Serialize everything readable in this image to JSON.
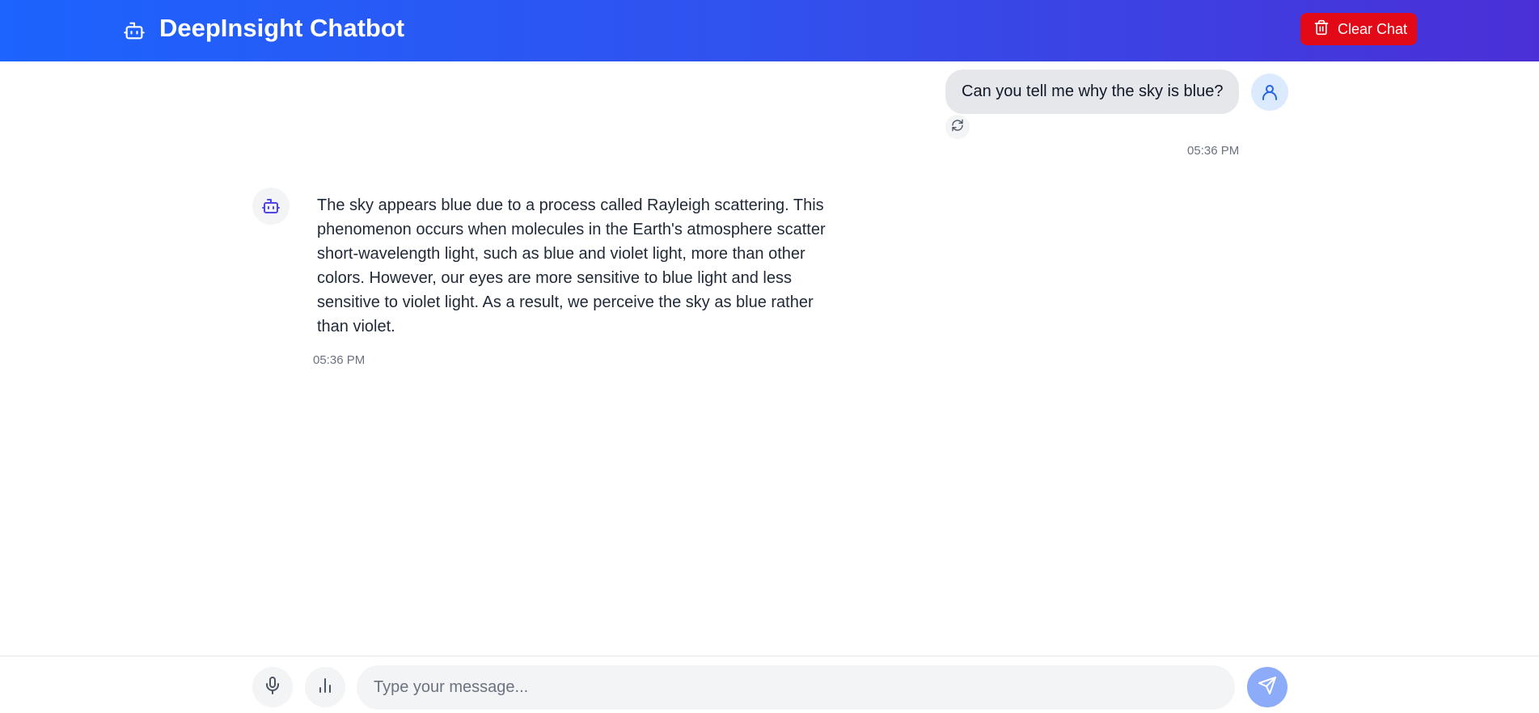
{
  "header": {
    "title": "DeepInsight Chatbot",
    "logo_icon": "robot-icon",
    "clear_button_label": "Clear Chat",
    "clear_button_icon": "trash-icon"
  },
  "messages": [
    {
      "role": "user",
      "text": "Can you tell me why the sky is blue?",
      "time": "05:36 PM",
      "avatar_icon": "user-icon",
      "action_icon": "refresh-icon"
    },
    {
      "role": "bot",
      "text": "The sky appears blue due to a process called Rayleigh scattering. This phenomenon occurs when molecules in the Earth's atmosphere scatter short-wavelength light, such as blue and violet light, more than other colors. However, our eyes are more sensitive to blue light and less sensitive to violet light. As a result, we perceive the sky as blue rather than violet.",
      "time": "05:36 PM",
      "avatar_icon": "robot-icon"
    }
  ],
  "composer": {
    "placeholder": "Type your message...",
    "value": "",
    "mic_icon": "microphone-icon",
    "stats_icon": "bar-chart-icon",
    "send_icon": "send-icon"
  },
  "colors": {
    "header_gradient_start": "#1d63fd",
    "header_gradient_end": "#4a2fd6",
    "clear_button": "#e30a17",
    "user_bubble": "#e5e7eb",
    "send_button": "#8cacfa",
    "bot_icon": "#4f46e5",
    "user_icon": "#2563eb"
  }
}
